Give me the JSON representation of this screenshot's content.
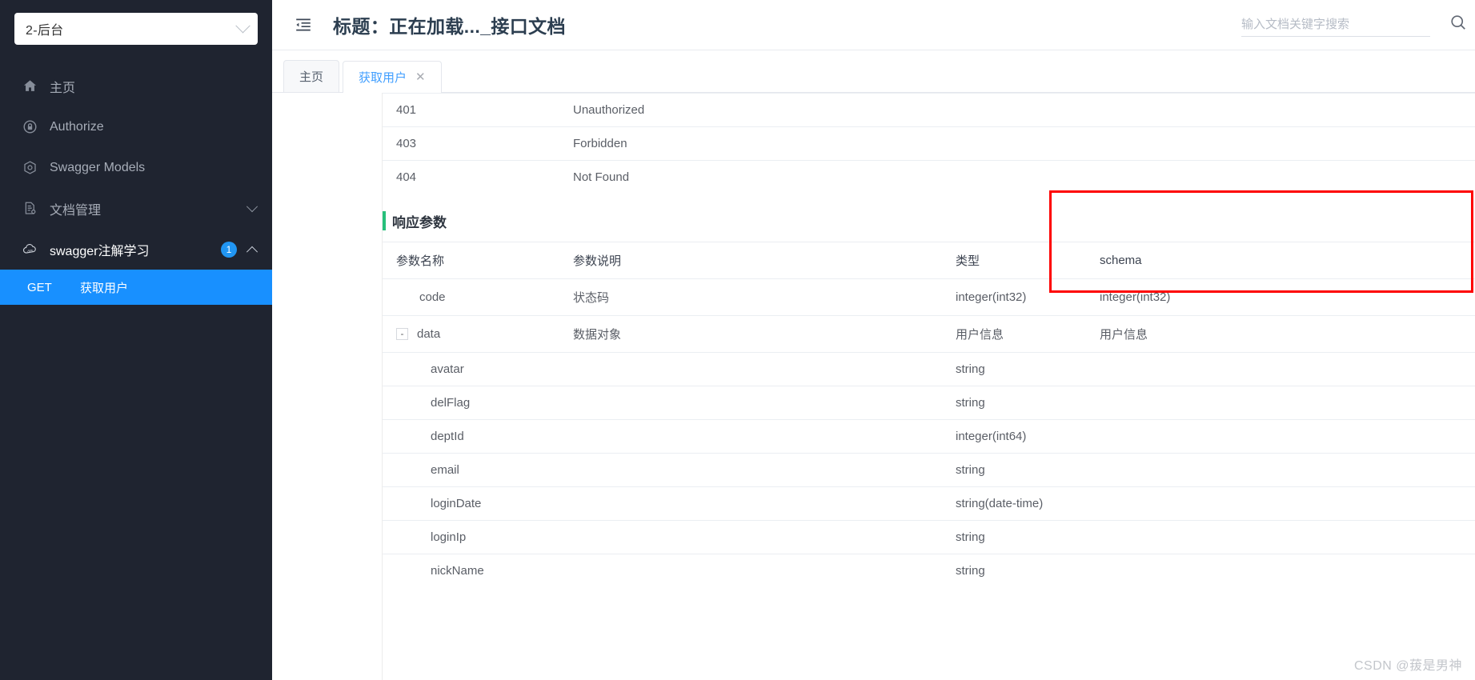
{
  "sidebar": {
    "project_select": {
      "value": "2-后台",
      "icon": "chevron-down-icon"
    },
    "items": [
      {
        "label": "主页",
        "icon": "home-icon"
      },
      {
        "label": "Authorize",
        "icon": "lock-icon"
      },
      {
        "label": "Swagger Models",
        "icon": "cube-icon"
      },
      {
        "label": "文档管理",
        "icon": "document-settings-icon",
        "trailing_icon": "chevron-down-icon"
      },
      {
        "label": "swagger注解学习",
        "icon": "cloud-api-icon",
        "badge": "1",
        "trailing_icon": "chevron-up-icon"
      }
    ],
    "api_item": {
      "method": "GET",
      "name": "获取用户"
    }
  },
  "header": {
    "collapse_icon": "menu-collapse-icon",
    "title": "标题：正在加载..._接口文档",
    "search": {
      "placeholder": "输入文档关键字搜索",
      "value": "",
      "icon": "search-icon"
    }
  },
  "tabs": [
    {
      "label": "主页",
      "active": false,
      "closable": false
    },
    {
      "label": "获取用户",
      "active": true,
      "closable": true,
      "close_label": "✕"
    }
  ],
  "content": {
    "response_codes": {
      "rows": [
        {
          "code": "401",
          "desc": "Unauthorized"
        },
        {
          "code": "403",
          "desc": "Forbidden"
        },
        {
          "code": "404",
          "desc": "Not Found"
        }
      ]
    },
    "response_params": {
      "section_title": "响应参数",
      "columns": {
        "name": "参数名称",
        "desc": "参数说明",
        "type": "类型",
        "schema": "schema"
      },
      "rows": [
        {
          "name": "code",
          "indent": 1,
          "toggle": "",
          "desc": "状态码",
          "type": "integer(int32)",
          "schema": "integer(int32)"
        },
        {
          "name": "data",
          "indent": 0,
          "toggle": "-",
          "desc": "数据对象",
          "type": "用户信息",
          "schema": "用户信息"
        },
        {
          "name": "avatar",
          "indent": 2,
          "toggle": "",
          "desc": "",
          "type": "string",
          "schema": ""
        },
        {
          "name": "delFlag",
          "indent": 2,
          "toggle": "",
          "desc": "",
          "type": "string",
          "schema": ""
        },
        {
          "name": "deptId",
          "indent": 2,
          "toggle": "",
          "desc": "",
          "type": "integer(int64)",
          "schema": ""
        },
        {
          "name": "email",
          "indent": 2,
          "toggle": "",
          "desc": "",
          "type": "string",
          "schema": ""
        },
        {
          "name": "loginDate",
          "indent": 2,
          "toggle": "",
          "desc": "",
          "type": "string(date-time)",
          "schema": ""
        },
        {
          "name": "loginIp",
          "indent": 2,
          "toggle": "",
          "desc": "",
          "type": "string",
          "schema": ""
        },
        {
          "name": "nickName",
          "indent": 2,
          "toggle": "",
          "desc": "",
          "type": "string",
          "schema": ""
        }
      ]
    }
  },
  "annotation": {
    "highlight_color": "#fe0000"
  },
  "watermark": {
    "text": "CSDN @菝是男神"
  },
  "colors": {
    "sidebar_bg": "#1f2430",
    "accent_blue": "#1890ff",
    "tab_active": "#409eff",
    "section_bar_green": "#27c07b"
  }
}
